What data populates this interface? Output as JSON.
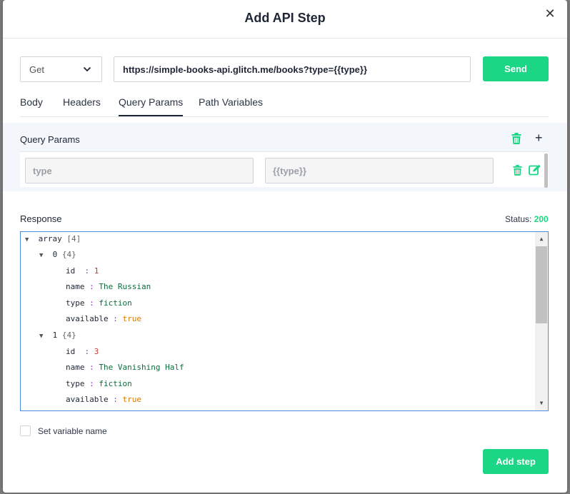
{
  "modal": {
    "title": "Add API Step",
    "close_glyph": "✕"
  },
  "request": {
    "method": "Get",
    "url": "https://simple-books-api.glitch.me/books?type={{type}}",
    "send_label": "Send"
  },
  "tabs": [
    {
      "label": "Body"
    },
    {
      "label": "Headers"
    },
    {
      "label": "Query Params",
      "active": true
    },
    {
      "label": "Path Variables"
    }
  ],
  "query_params": {
    "title": "Query Params",
    "add_glyph": "+",
    "rows": [
      {
        "key": "type",
        "value": "{{type}}"
      }
    ]
  },
  "response": {
    "label": "Response",
    "status_label": "Status:",
    "status_code": "200",
    "tree": {
      "root": {
        "key": "array",
        "meta": "[4]"
      },
      "items": [
        {
          "index": "0",
          "meta": "{4}",
          "fields": [
            {
              "k": "id",
              "v": "1",
              "type": "num"
            },
            {
              "k": "name",
              "v": "The Russian",
              "type": "str"
            },
            {
              "k": "type",
              "v": "fiction",
              "type": "str"
            },
            {
              "k": "available",
              "v": "true",
              "type": "bool"
            }
          ]
        },
        {
          "index": "1",
          "meta": "{4}",
          "fields": [
            {
              "k": "id",
              "v": "3",
              "type": "num"
            },
            {
              "k": "name",
              "v": "The Vanishing Half",
              "type": "str"
            },
            {
              "k": "type",
              "v": "fiction",
              "type": "str"
            },
            {
              "k": "available",
              "v": "true",
              "type": "bool"
            }
          ]
        }
      ]
    }
  },
  "set_variable": {
    "label": "Set variable name",
    "checked": false
  },
  "footer": {
    "add_step_label": "Add step"
  },
  "colors": {
    "accent": "#1bd684",
    "focus_border": "#4a8be0"
  }
}
